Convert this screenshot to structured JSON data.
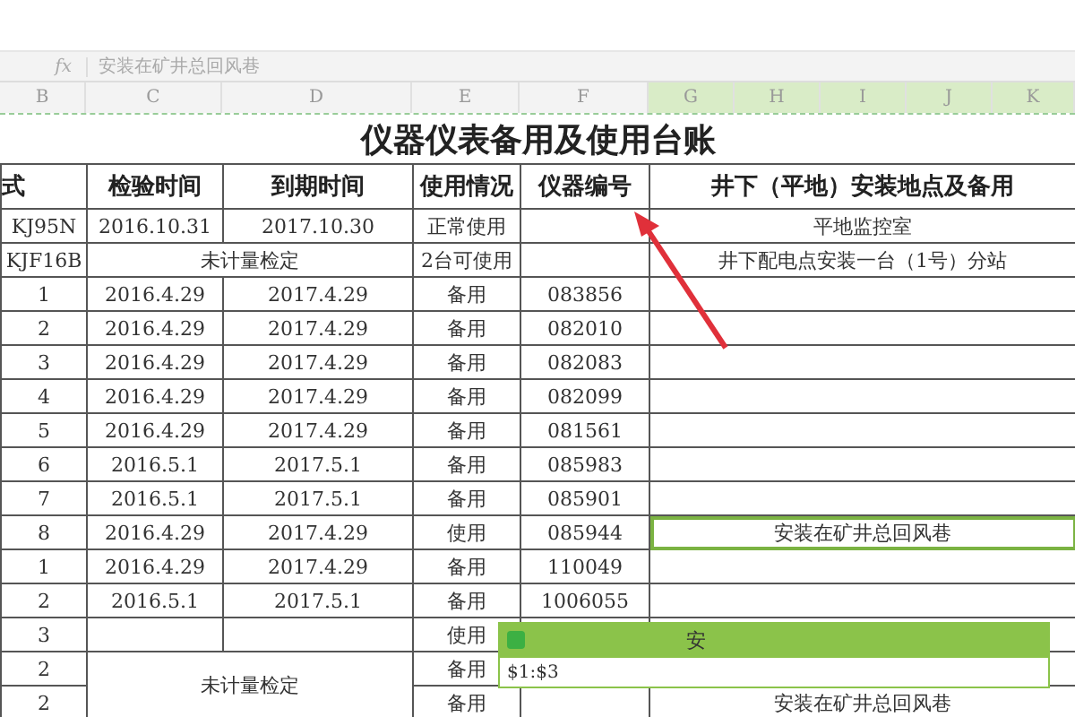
{
  "formula_bar": {
    "fx": "fx",
    "value": "安装在矿井总回风巷"
  },
  "columns": [
    {
      "label": "B",
      "selected": false
    },
    {
      "label": "C",
      "selected": false
    },
    {
      "label": "D",
      "selected": false
    },
    {
      "label": "E",
      "selected": false
    },
    {
      "label": "F",
      "selected": false
    },
    {
      "label": "G",
      "selected": true
    },
    {
      "label": "H",
      "selected": true
    },
    {
      "label": "I",
      "selected": true
    },
    {
      "label": "J",
      "selected": true
    },
    {
      "label": "K",
      "selected": true
    }
  ],
  "sheet_title": "仪器仪表备用及使用台账",
  "headers": [
    "式",
    "检验时间",
    "到期时间",
    "使用情况",
    "仪器编号",
    "井下（平地）安装地点及备用"
  ],
  "rows": [
    {
      "kind": "normal",
      "model": "KJ95N",
      "checked": "2016.10.31",
      "expires": "2017.10.30",
      "status": "正常使用",
      "number": "",
      "location": "平地监控室",
      "location_selected": false
    },
    {
      "kind": "merged",
      "model": "KJF16B",
      "merged": "未计量检定",
      "status": "2台可使用",
      "number": "",
      "location": "井下配电点安装一台（1号）分站",
      "location_selected": false
    },
    {
      "kind": "normal",
      "model": "1",
      "checked": "2016.4.29",
      "expires": "2017.4.29",
      "status": "备用",
      "number": "083856",
      "location": "",
      "location_selected": false
    },
    {
      "kind": "normal",
      "model": "2",
      "checked": "2016.4.29",
      "expires": "2017.4.29",
      "status": "备用",
      "number": "082010",
      "location": "",
      "location_selected": false
    },
    {
      "kind": "normal",
      "model": "3",
      "checked": "2016.4.29",
      "expires": "2017.4.29",
      "status": "备用",
      "number": "082083",
      "location": "",
      "location_selected": false
    },
    {
      "kind": "normal",
      "model": "4",
      "checked": "2016.4.29",
      "expires": "2017.4.29",
      "status": "备用",
      "number": "082099",
      "location": "",
      "location_selected": false
    },
    {
      "kind": "normal",
      "model": "5",
      "checked": "2016.4.29",
      "expires": "2017.4.29",
      "status": "备用",
      "number": "081561",
      "location": "",
      "location_selected": false
    },
    {
      "kind": "normal",
      "model": "6",
      "checked": "2016.5.1",
      "expires": "2017.5.1",
      "status": "备用",
      "number": "085983",
      "location": "",
      "location_selected": false
    },
    {
      "kind": "normal",
      "model": "7",
      "checked": "2016.5.1",
      "expires": "2017.5.1",
      "status": "备用",
      "number": "085901",
      "location": "",
      "location_selected": false
    },
    {
      "kind": "normal",
      "model": "8",
      "checked": "2016.4.29",
      "expires": "2017.4.29",
      "status": "使用",
      "number": "085944",
      "location": "安装在矿井总回风巷",
      "location_selected": true
    },
    {
      "kind": "normal",
      "model": "1",
      "checked": "2016.4.29",
      "expires": "2017.4.29",
      "status": "备用",
      "number": "110049",
      "location": "",
      "location_selected": false
    },
    {
      "kind": "normal",
      "model": "2",
      "checked": "2016.5.1",
      "expires": "2017.5.1",
      "status": "备用",
      "number": "1006055",
      "location": "",
      "location_selected": false
    },
    {
      "kind": "normal",
      "model": "3",
      "checked": "",
      "expires": "",
      "status": "使用",
      "number": "",
      "location": "",
      "location_selected": false
    },
    {
      "kind": "span_top",
      "model": "2",
      "merged": "未计量检定",
      "status": "备用",
      "number": "",
      "location": "",
      "location_selected": false
    },
    {
      "kind": "span_rest",
      "model": "2",
      "status": "备用",
      "number": "",
      "location": "安装在矿井总回风巷",
      "location_selected": false
    }
  ],
  "dialog": {
    "title": "安",
    "range": "$1:$3"
  }
}
